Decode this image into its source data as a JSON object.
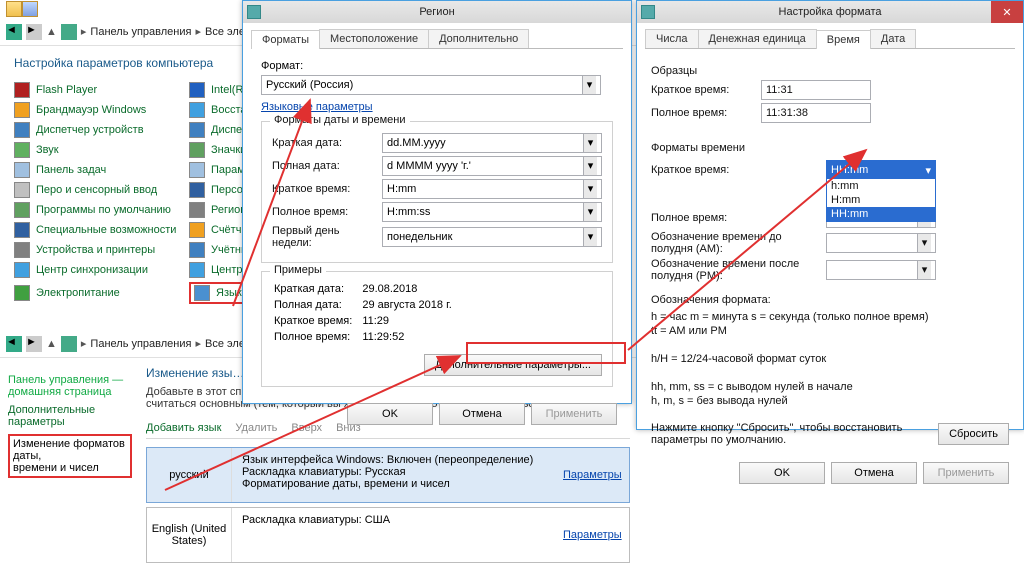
{
  "control_panel": {
    "breadcrumb": [
      "Панель управления",
      "Все элем…"
    ],
    "title": "Настройка параметров компьютера",
    "col1": [
      {
        "icon": "flash",
        "label": "Flash Player"
      },
      {
        "icon": "shield",
        "label": "Брандмауэр Windows"
      },
      {
        "icon": "gear",
        "label": "Диспетчер устройств"
      },
      {
        "icon": "sound",
        "label": "Звук"
      },
      {
        "icon": "panel",
        "label": "Панель задач"
      },
      {
        "icon": "pen",
        "label": "Перо и сенсорный ввод"
      },
      {
        "icon": "prog",
        "label": "Программы по умолчанию"
      },
      {
        "icon": "ease",
        "label": "Специальные возможности"
      },
      {
        "icon": "dev",
        "label": "Устройства и принтеры"
      },
      {
        "icon": "sync",
        "label": "Центр синхронизации"
      },
      {
        "icon": "power",
        "label": "Электропитание"
      }
    ],
    "col2": [
      {
        "icon": "intel",
        "label": "Intel(R) C…"
      },
      {
        "icon": "sync",
        "label": "Восстан…"
      },
      {
        "icon": "gear",
        "label": "Диспетч…"
      },
      {
        "icon": "prog",
        "label": "Значки …"
      },
      {
        "icon": "panel",
        "label": "Парамет…"
      },
      {
        "icon": "ease",
        "label": "Персона…"
      },
      {
        "icon": "dev",
        "label": "Региона…"
      },
      {
        "icon": "shield",
        "label": "Счётчик…"
      },
      {
        "icon": "gear",
        "label": "Учётные…"
      },
      {
        "icon": "sync",
        "label": "Центр у…"
      },
      {
        "icon": "lang",
        "label": "Язык"
      }
    ]
  },
  "region_dialog": {
    "title": "Регион",
    "tabs": [
      "Форматы",
      "Местоположение",
      "Дополнительно"
    ],
    "format_label": "Формат:",
    "format_value": "Русский (Россия)",
    "lang_link": "Языковые параметры",
    "group_formats": "Форматы даты и времени",
    "rows": {
      "short_date": {
        "label": "Краткая дата:",
        "value": "dd.MM.yyyy"
      },
      "long_date": {
        "label": "Полная дата:",
        "value": "d MMMM yyyy 'г.'"
      },
      "short_time": {
        "label": "Краткое время:",
        "value": "H:mm"
      },
      "long_time": {
        "label": "Полное время:",
        "value": "H:mm:ss"
      },
      "first_day": {
        "label": "Первый день недели:",
        "value": "понедельник"
      }
    },
    "group_examples": "Примеры",
    "examples": {
      "short_date": {
        "label": "Краткая дата:",
        "value": "29.08.2018"
      },
      "long_date": {
        "label": "Полная дата:",
        "value": "29 августа 2018 г."
      },
      "short_time": {
        "label": "Краткое время:",
        "value": "11:29"
      },
      "long_time": {
        "label": "Полное время:",
        "value": "11:29:52"
      }
    },
    "extra_btn": "Дополнительные параметры...",
    "ok": "OK",
    "cancel": "Отмена",
    "apply": "Применить"
  },
  "lang_window": {
    "breadcrumb": [
      "Панель управления",
      "Все элем…"
    ],
    "side": {
      "home1": "Панель управления —",
      "home2": "домашняя страница",
      "more": "Дополнительные параметры",
      "active1": "Изменение форматов даты,",
      "active2": "времени и чисел"
    },
    "heading": "Изменение язы…",
    "hint": "Добавьте в этот список языки, которые вы хотите использовать. Язык вверху списка будет считаться основным (тем, который вы хотите чаще всего видеть и использовать).",
    "toolbar": {
      "add": "Добавить язык",
      "del": "Удалить",
      "up": "Вверх",
      "down": "Вниз"
    },
    "langs": [
      {
        "name": "русский",
        "lines": [
          "Язык интерфейса Windows: Включен (переопределение)",
          "Раскладка клавиатуры: Русская",
          "Форматирование даты, времени и чисел"
        ],
        "opt": "Параметры"
      },
      {
        "name": "English (United States)",
        "lines": [
          "Раскладка клавиатуры: США"
        ],
        "opt": "Параметры"
      }
    ]
  },
  "format_settings": {
    "title": "Настройка формата",
    "tabs": [
      "Числа",
      "Денежная единица",
      "Время",
      "Дата"
    ],
    "samples_title": "Образцы",
    "sample_short": {
      "label": "Краткое время:",
      "value": "11:31"
    },
    "sample_long": {
      "label": "Полное время:",
      "value": "11:31:38"
    },
    "group": "Форматы времени",
    "rows": {
      "short": {
        "label": "Краткое время:",
        "selected": "HH:mm",
        "options": [
          "h:mm",
          "H:mm",
          "HH:mm"
        ]
      },
      "long": {
        "label": "Полное время:"
      },
      "am": {
        "label": "Обозначение времени до полудня (AM):"
      },
      "pm": {
        "label": "Обозначение времени после полудня (PM):"
      }
    },
    "notation_title": "Обозначения формата:",
    "notation_lines": [
      "h = час    m = минута    s = секунда (только полное время)",
      "tt = AM или PM",
      "",
      "h/H = 12/24-часовой формат суток",
      "",
      "hh, mm, ss = с выводом нулей в начале",
      "h, m, s = без вывода нулей"
    ],
    "reset_hint": "Нажмите кнопку \"Сбросить\", чтобы восстановить параметры по умолчанию.",
    "reset": "Сбросить",
    "ok": "OK",
    "cancel": "Отмена",
    "apply": "Применить"
  }
}
